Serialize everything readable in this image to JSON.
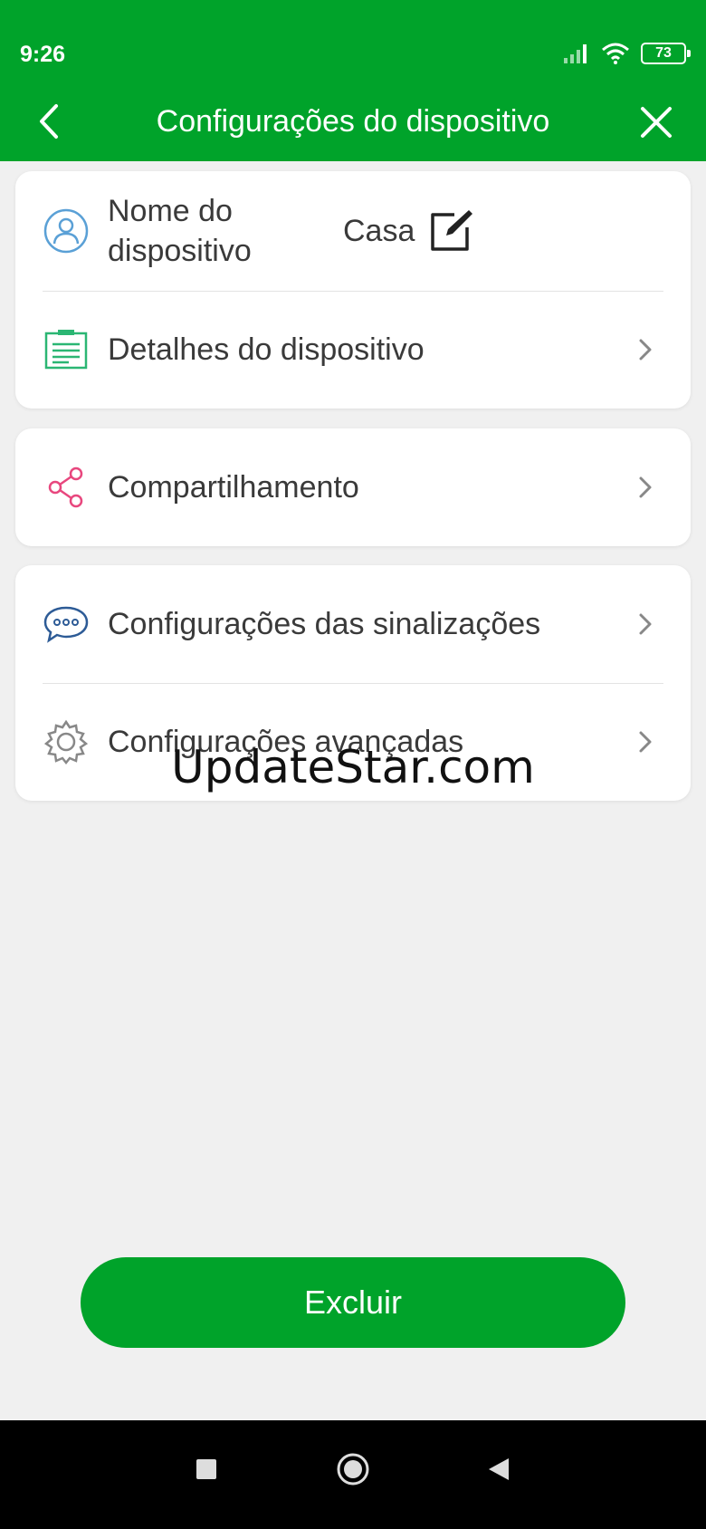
{
  "status_bar": {
    "time": "9:26",
    "battery": "73"
  },
  "header": {
    "title": "Configurações do dispositivo"
  },
  "device_name_row": {
    "label": "Nome do dispositivo",
    "value": "Casa"
  },
  "rows": {
    "details": "Detalhes do dispositivo",
    "sharing": "Compartilhamento",
    "signal_settings": "Configurações das sinalizações",
    "advanced_settings": "Configurações avançadas"
  },
  "watermark": "UpdateStar.com",
  "delete_button": "Excluir",
  "colors": {
    "brand_green": "#00a32a",
    "share_pink": "#e8477e",
    "info_blue": "#2d5b96",
    "details_green": "#2bb673"
  }
}
